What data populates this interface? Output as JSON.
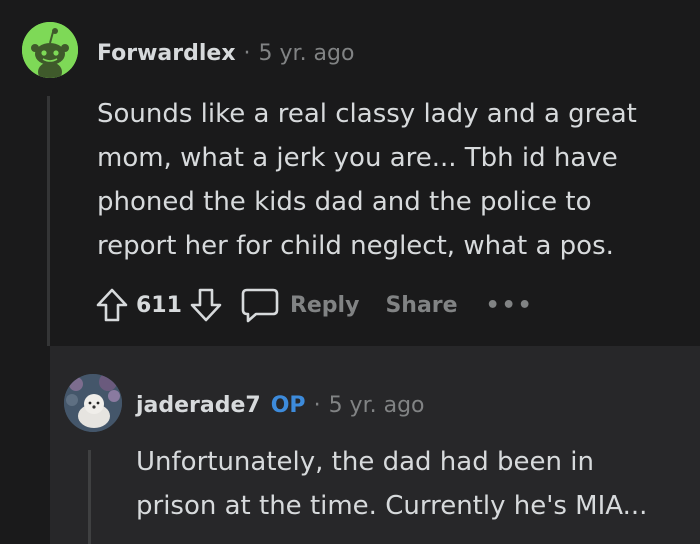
{
  "comment": {
    "author": "Forwardlex",
    "separator": "·",
    "age": "5 yr. ago",
    "body": "Sounds like a real classy lady and a great mom, what a jerk you are... Tbh id have phoned the kids dad and the police to report her for child neglect, what a pos.",
    "score": "611",
    "reply_label": "Reply",
    "share_label": "Share",
    "more_label": "•••"
  },
  "reply": {
    "author": "jaderade7",
    "badge": "OP",
    "separator": "·",
    "age": "5 yr. ago",
    "body": "Unfortunately, the dad had been in prison at the time. Currently he's MIA..."
  },
  "colors": {
    "background": "#1a1a1b",
    "reply_background": "#272729",
    "op_badge": "#3d8bdb",
    "avatar_green": "#7ed957"
  }
}
